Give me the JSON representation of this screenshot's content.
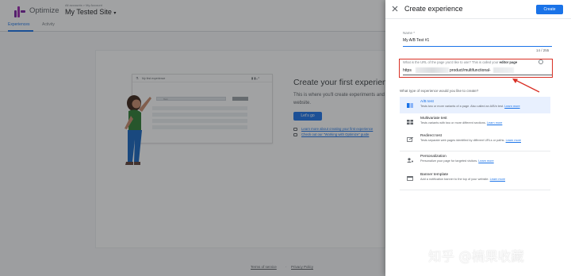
{
  "app": {
    "product_name": "Optimize",
    "account_line": "All accounts > My Account",
    "site_name": "My Tested Site",
    "tabs": [
      {
        "label": "Experiences",
        "active": true
      },
      {
        "label": "Activity",
        "active": false
      }
    ]
  },
  "hero": {
    "mock_title": "My first experience",
    "mock_input": "Test",
    "title": "Create your first experien",
    "description": "This is where you'll create experiments and website.",
    "cta_label": "Let's go",
    "links": [
      "Learn more about creating your first experience",
      "Check out our \"Working with Optimize\" guide"
    ]
  },
  "footer": {
    "terms": "Terms of service",
    "privacy": "Privacy Policy"
  },
  "drawer": {
    "title": "Create experience",
    "create_label": "Create",
    "name_label": "Name *",
    "name_value": "My A/B Test #1",
    "name_counter": "14 / 255",
    "url_label_prefix": "What is the URL of the page you'd like to use? This is called your",
    "url_label_bold": "editor page",
    "url_prefix": "https",
    "url_path": "product/multifunctional-",
    "type_label": "What type of experience would you like to create?",
    "options": [
      {
        "icon": "ab-test-icon",
        "title": "A/B test",
        "desc": "Tests two or more variants of a page. Also called an A/B/n test.",
        "link": "Learn more",
        "selected": true
      },
      {
        "icon": "multivariate-icon",
        "title": "Multivariate test",
        "desc": "Tests variants with two or more different sections.",
        "link": "Learn more",
        "selected": false
      },
      {
        "icon": "redirect-icon",
        "title": "Redirect test",
        "desc": "Tests separate web pages identified by different URLs or paths.",
        "link": "Learn more",
        "selected": false
      },
      {
        "icon": "personalization-icon",
        "title": "Personalization",
        "desc": "Personalize your page for targeted visitors.",
        "link": "Learn more",
        "selected": false
      },
      {
        "icon": "banner-icon",
        "title": "Banner template",
        "desc": "Add a notification banner to the top of your website.",
        "link": "Learn more",
        "selected": false
      }
    ]
  },
  "watermark": "知乎 @楠果收藏",
  "colors": {
    "accent": "#1a73e8",
    "highlight": "#d93025",
    "brand": "#7b1fa2"
  }
}
